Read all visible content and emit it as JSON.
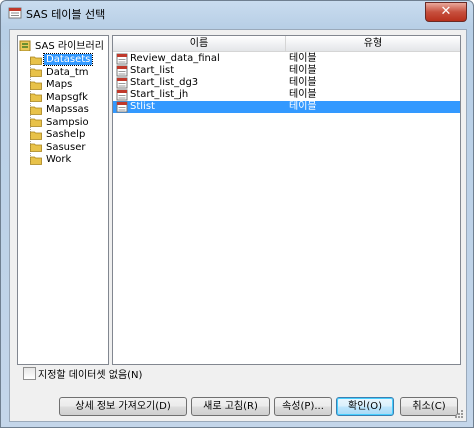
{
  "window": {
    "title": "SAS 테이블 선택",
    "close_label": "✕"
  },
  "tree": {
    "root": "SAS 라이브러리",
    "libraries": [
      "Datasets",
      "Data_tm",
      "Maps",
      "Mapsgfk",
      "Mapssas",
      "Sampsio",
      "Sashelp",
      "Sasuser",
      "Work"
    ],
    "selected": "Datasets"
  },
  "table": {
    "columns": [
      "이름",
      "유형"
    ],
    "rows": [
      {
        "name": "Review_data_final",
        "type": "테이블"
      },
      {
        "name": "Start_list",
        "type": "테이블"
      },
      {
        "name": "Start_list_dg3",
        "type": "테이블"
      },
      {
        "name": "Start_list_jh",
        "type": "테이블"
      },
      {
        "name": "Stlist",
        "type": "테이블"
      }
    ],
    "selected_row": "Stlist"
  },
  "options": {
    "no_dataset_label": "지정할 데이터셋 없음(N)",
    "no_dataset_checked": false
  },
  "buttons": {
    "details": "상세 정보 가져오기(D)",
    "refresh": "새로 고침(R)",
    "properties": "속성(P)...",
    "ok": "확인(O)",
    "cancel": "취소(C)"
  },
  "colors": {
    "selection": "#3399ff",
    "folder": "#e8c24a",
    "title_bg": "#b8cfe6"
  }
}
